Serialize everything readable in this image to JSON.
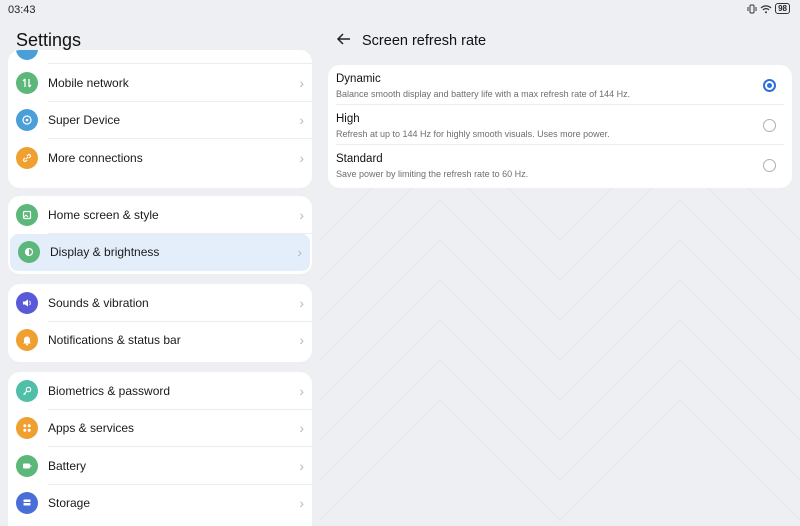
{
  "status": {
    "time": "03:43",
    "battery": "98"
  },
  "left": {
    "title": "Settings",
    "groups": [
      {
        "items": [
          {
            "label": "Mobile network",
            "icon": "mobile-network-icon",
            "color": "#5cb77a"
          },
          {
            "label": "Super Device",
            "icon": "super-device-icon",
            "color": "#4a9fd8"
          },
          {
            "label": "More connections",
            "icon": "link-icon",
            "color": "#f0a030"
          }
        ]
      },
      {
        "items": [
          {
            "label": "Home screen & style",
            "icon": "home-screen-icon",
            "color": "#5cb77a"
          },
          {
            "label": "Display & brightness",
            "icon": "display-icon",
            "color": "#5cb77a",
            "selected": true
          }
        ]
      },
      {
        "items": [
          {
            "label": "Sounds & vibration",
            "icon": "speaker-icon",
            "color": "#5a5ad8"
          },
          {
            "label": "Notifications & status bar",
            "icon": "bell-icon",
            "color": "#f0a030"
          }
        ]
      },
      {
        "items": [
          {
            "label": "Biometrics & password",
            "icon": "key-icon",
            "color": "#4fbfa8"
          },
          {
            "label": "Apps & services",
            "icon": "apps-icon",
            "color": "#f0a030"
          },
          {
            "label": "Battery",
            "icon": "battery-icon",
            "color": "#5cb77a"
          },
          {
            "label": "Storage",
            "icon": "storage-icon",
            "color": "#4a6ed8"
          }
        ]
      }
    ]
  },
  "right": {
    "title": "Screen refresh rate",
    "options": [
      {
        "title": "Dynamic",
        "desc": "Balance smooth display and battery life with a max refresh rate of 144 Hz.",
        "selected": true
      },
      {
        "title": "High",
        "desc": "Refresh at up to 144 Hz for highly smooth visuals. Uses more power.",
        "selected": false
      },
      {
        "title": "Standard",
        "desc": "Save power by limiting the refresh rate to 60 Hz.",
        "selected": false
      }
    ]
  },
  "colors": {
    "accent": "#2d6ee0",
    "selected_bg": "#e4eefb"
  }
}
